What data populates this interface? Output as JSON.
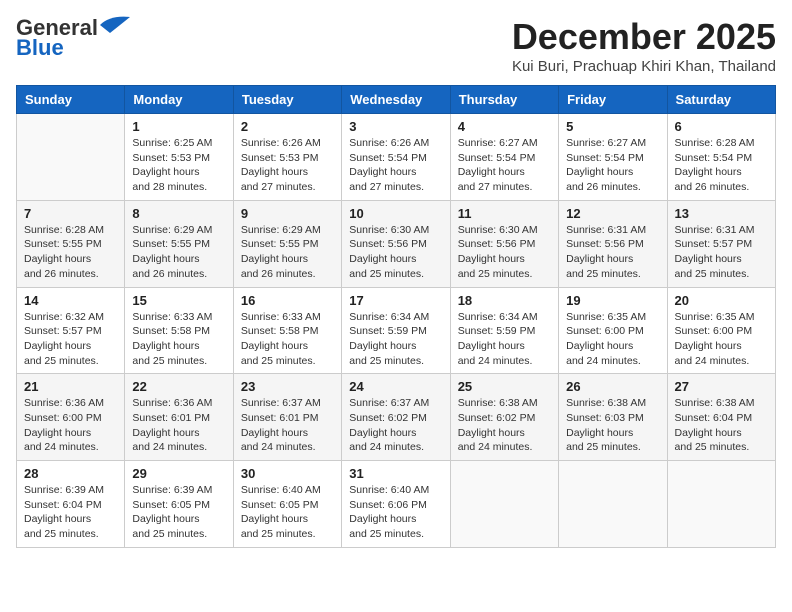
{
  "header": {
    "logo_line1": "General",
    "logo_line2": "Blue",
    "month": "December 2025",
    "location": "Kui Buri, Prachuap Khiri Khan, Thailand"
  },
  "weekdays": [
    "Sunday",
    "Monday",
    "Tuesday",
    "Wednesday",
    "Thursday",
    "Friday",
    "Saturday"
  ],
  "weeks": [
    [
      {
        "day": "",
        "sunrise": "",
        "sunset": "",
        "daylight": ""
      },
      {
        "day": "1",
        "sunrise": "6:25 AM",
        "sunset": "5:53 PM",
        "daylight": "11 hours and 28 minutes."
      },
      {
        "day": "2",
        "sunrise": "6:26 AM",
        "sunset": "5:53 PM",
        "daylight": "11 hours and 27 minutes."
      },
      {
        "day": "3",
        "sunrise": "6:26 AM",
        "sunset": "5:54 PM",
        "daylight": "11 hours and 27 minutes."
      },
      {
        "day": "4",
        "sunrise": "6:27 AM",
        "sunset": "5:54 PM",
        "daylight": "11 hours and 27 minutes."
      },
      {
        "day": "5",
        "sunrise": "6:27 AM",
        "sunset": "5:54 PM",
        "daylight": "11 hours and 26 minutes."
      },
      {
        "day": "6",
        "sunrise": "6:28 AM",
        "sunset": "5:54 PM",
        "daylight": "11 hours and 26 minutes."
      }
    ],
    [
      {
        "day": "7",
        "sunrise": "6:28 AM",
        "sunset": "5:55 PM",
        "daylight": "11 hours and 26 minutes."
      },
      {
        "day": "8",
        "sunrise": "6:29 AM",
        "sunset": "5:55 PM",
        "daylight": "11 hours and 26 minutes."
      },
      {
        "day": "9",
        "sunrise": "6:29 AM",
        "sunset": "5:55 PM",
        "daylight": "11 hours and 26 minutes."
      },
      {
        "day": "10",
        "sunrise": "6:30 AM",
        "sunset": "5:56 PM",
        "daylight": "11 hours and 25 minutes."
      },
      {
        "day": "11",
        "sunrise": "6:30 AM",
        "sunset": "5:56 PM",
        "daylight": "11 hours and 25 minutes."
      },
      {
        "day": "12",
        "sunrise": "6:31 AM",
        "sunset": "5:56 PM",
        "daylight": "11 hours and 25 minutes."
      },
      {
        "day": "13",
        "sunrise": "6:31 AM",
        "sunset": "5:57 PM",
        "daylight": "11 hours and 25 minutes."
      }
    ],
    [
      {
        "day": "14",
        "sunrise": "6:32 AM",
        "sunset": "5:57 PM",
        "daylight": "11 hours and 25 minutes."
      },
      {
        "day": "15",
        "sunrise": "6:33 AM",
        "sunset": "5:58 PM",
        "daylight": "11 hours and 25 minutes."
      },
      {
        "day": "16",
        "sunrise": "6:33 AM",
        "sunset": "5:58 PM",
        "daylight": "11 hours and 25 minutes."
      },
      {
        "day": "17",
        "sunrise": "6:34 AM",
        "sunset": "5:59 PM",
        "daylight": "11 hours and 25 minutes."
      },
      {
        "day": "18",
        "sunrise": "6:34 AM",
        "sunset": "5:59 PM",
        "daylight": "11 hours and 24 minutes."
      },
      {
        "day": "19",
        "sunrise": "6:35 AM",
        "sunset": "6:00 PM",
        "daylight": "11 hours and 24 minutes."
      },
      {
        "day": "20",
        "sunrise": "6:35 AM",
        "sunset": "6:00 PM",
        "daylight": "11 hours and 24 minutes."
      }
    ],
    [
      {
        "day": "21",
        "sunrise": "6:36 AM",
        "sunset": "6:00 PM",
        "daylight": "11 hours and 24 minutes."
      },
      {
        "day": "22",
        "sunrise": "6:36 AM",
        "sunset": "6:01 PM",
        "daylight": "11 hours and 24 minutes."
      },
      {
        "day": "23",
        "sunrise": "6:37 AM",
        "sunset": "6:01 PM",
        "daylight": "11 hours and 24 minutes."
      },
      {
        "day": "24",
        "sunrise": "6:37 AM",
        "sunset": "6:02 PM",
        "daylight": "11 hours and 24 minutes."
      },
      {
        "day": "25",
        "sunrise": "6:38 AM",
        "sunset": "6:02 PM",
        "daylight": "11 hours and 24 minutes."
      },
      {
        "day": "26",
        "sunrise": "6:38 AM",
        "sunset": "6:03 PM",
        "daylight": "11 hours and 25 minutes."
      },
      {
        "day": "27",
        "sunrise": "6:38 AM",
        "sunset": "6:04 PM",
        "daylight": "11 hours and 25 minutes."
      }
    ],
    [
      {
        "day": "28",
        "sunrise": "6:39 AM",
        "sunset": "6:04 PM",
        "daylight": "11 hours and 25 minutes."
      },
      {
        "day": "29",
        "sunrise": "6:39 AM",
        "sunset": "6:05 PM",
        "daylight": "11 hours and 25 minutes."
      },
      {
        "day": "30",
        "sunrise": "6:40 AM",
        "sunset": "6:05 PM",
        "daylight": "11 hours and 25 minutes."
      },
      {
        "day": "31",
        "sunrise": "6:40 AM",
        "sunset": "6:06 PM",
        "daylight": "11 hours and 25 minutes."
      },
      {
        "day": "",
        "sunrise": "",
        "sunset": "",
        "daylight": ""
      },
      {
        "day": "",
        "sunrise": "",
        "sunset": "",
        "daylight": ""
      },
      {
        "day": "",
        "sunrise": "",
        "sunset": "",
        "daylight": ""
      }
    ]
  ]
}
